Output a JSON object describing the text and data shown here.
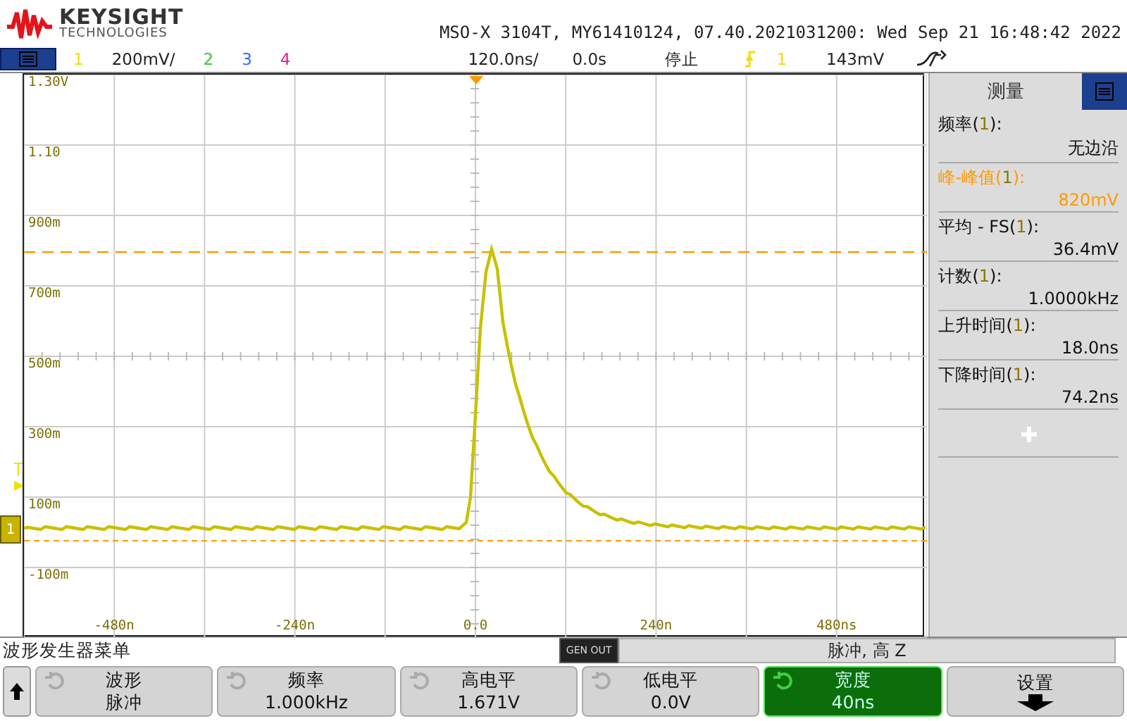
{
  "header": {
    "brand": "KEYSIGHT",
    "brand_sub": "TECHNOLOGIES",
    "title": "MSO-X 3104T, MY61410124, 07.40.2021031200: Wed Sep 21 16:48:42 2022"
  },
  "status_bar": {
    "channels": [
      {
        "number": "1",
        "scale": "200mV/",
        "color": "#f0e000"
      },
      {
        "number": "2",
        "color": "#33cc33"
      },
      {
        "number": "3",
        "color": "#3366ff"
      },
      {
        "number": "4",
        "color": "#e0208a"
      }
    ],
    "timebase": "120.0ns/",
    "delay": "0.0s",
    "run_state": "停止",
    "trigger_source": "1",
    "trigger_level": "143mV"
  },
  "graph": {
    "y_labels": [
      "1.30V",
      "1.10",
      "900m",
      "700m",
      "500m",
      "300m",
      "100m",
      "-100m"
    ],
    "x_labels": [
      "-480n",
      "-240n",
      "0.0",
      "240n",
      "480ns"
    ],
    "channel_marker": "1"
  },
  "measurements": {
    "title": "测量",
    "items": [
      {
        "name": "频率(",
        "source": "1",
        "end": "):",
        "value": "无边沿",
        "selected": false
      },
      {
        "name": "峰-峰值(",
        "source": "1",
        "end": "):",
        "value": "820mV",
        "selected": true
      },
      {
        "name": "平均 - FS(",
        "source": "1",
        "end": "):",
        "value": "36.4mV",
        "selected": false
      },
      {
        "name": "计数(",
        "source": "1",
        "end": "):",
        "value": "1.0000kHz",
        "selected": false
      },
      {
        "name": "上升时间(",
        "source": "1",
        "end": "):",
        "value": "18.0ns",
        "selected": false
      },
      {
        "name": "下降时间(",
        "source": "1",
        "end": "):",
        "value": "74.2ns",
        "selected": false
      }
    ]
  },
  "menu": {
    "title": "波形发生器菜单",
    "gen_badge": "GEN OUT",
    "gen_status": "脉冲, 高 Z",
    "softkeys": [
      {
        "kind": "value",
        "label": "波形",
        "value": "脉冲",
        "selected": false
      },
      {
        "kind": "value",
        "label": "频率",
        "value": "1.000kHz",
        "selected": false
      },
      {
        "kind": "value",
        "label": "高电平",
        "value": "1.671V",
        "selected": false
      },
      {
        "kind": "value",
        "label": "低电平",
        "value": "0.0V",
        "selected": false
      },
      {
        "kind": "value",
        "label": "宽度",
        "value": "40ns",
        "selected": true
      },
      {
        "kind": "submenu",
        "label": "设置",
        "selected": false
      }
    ]
  }
}
